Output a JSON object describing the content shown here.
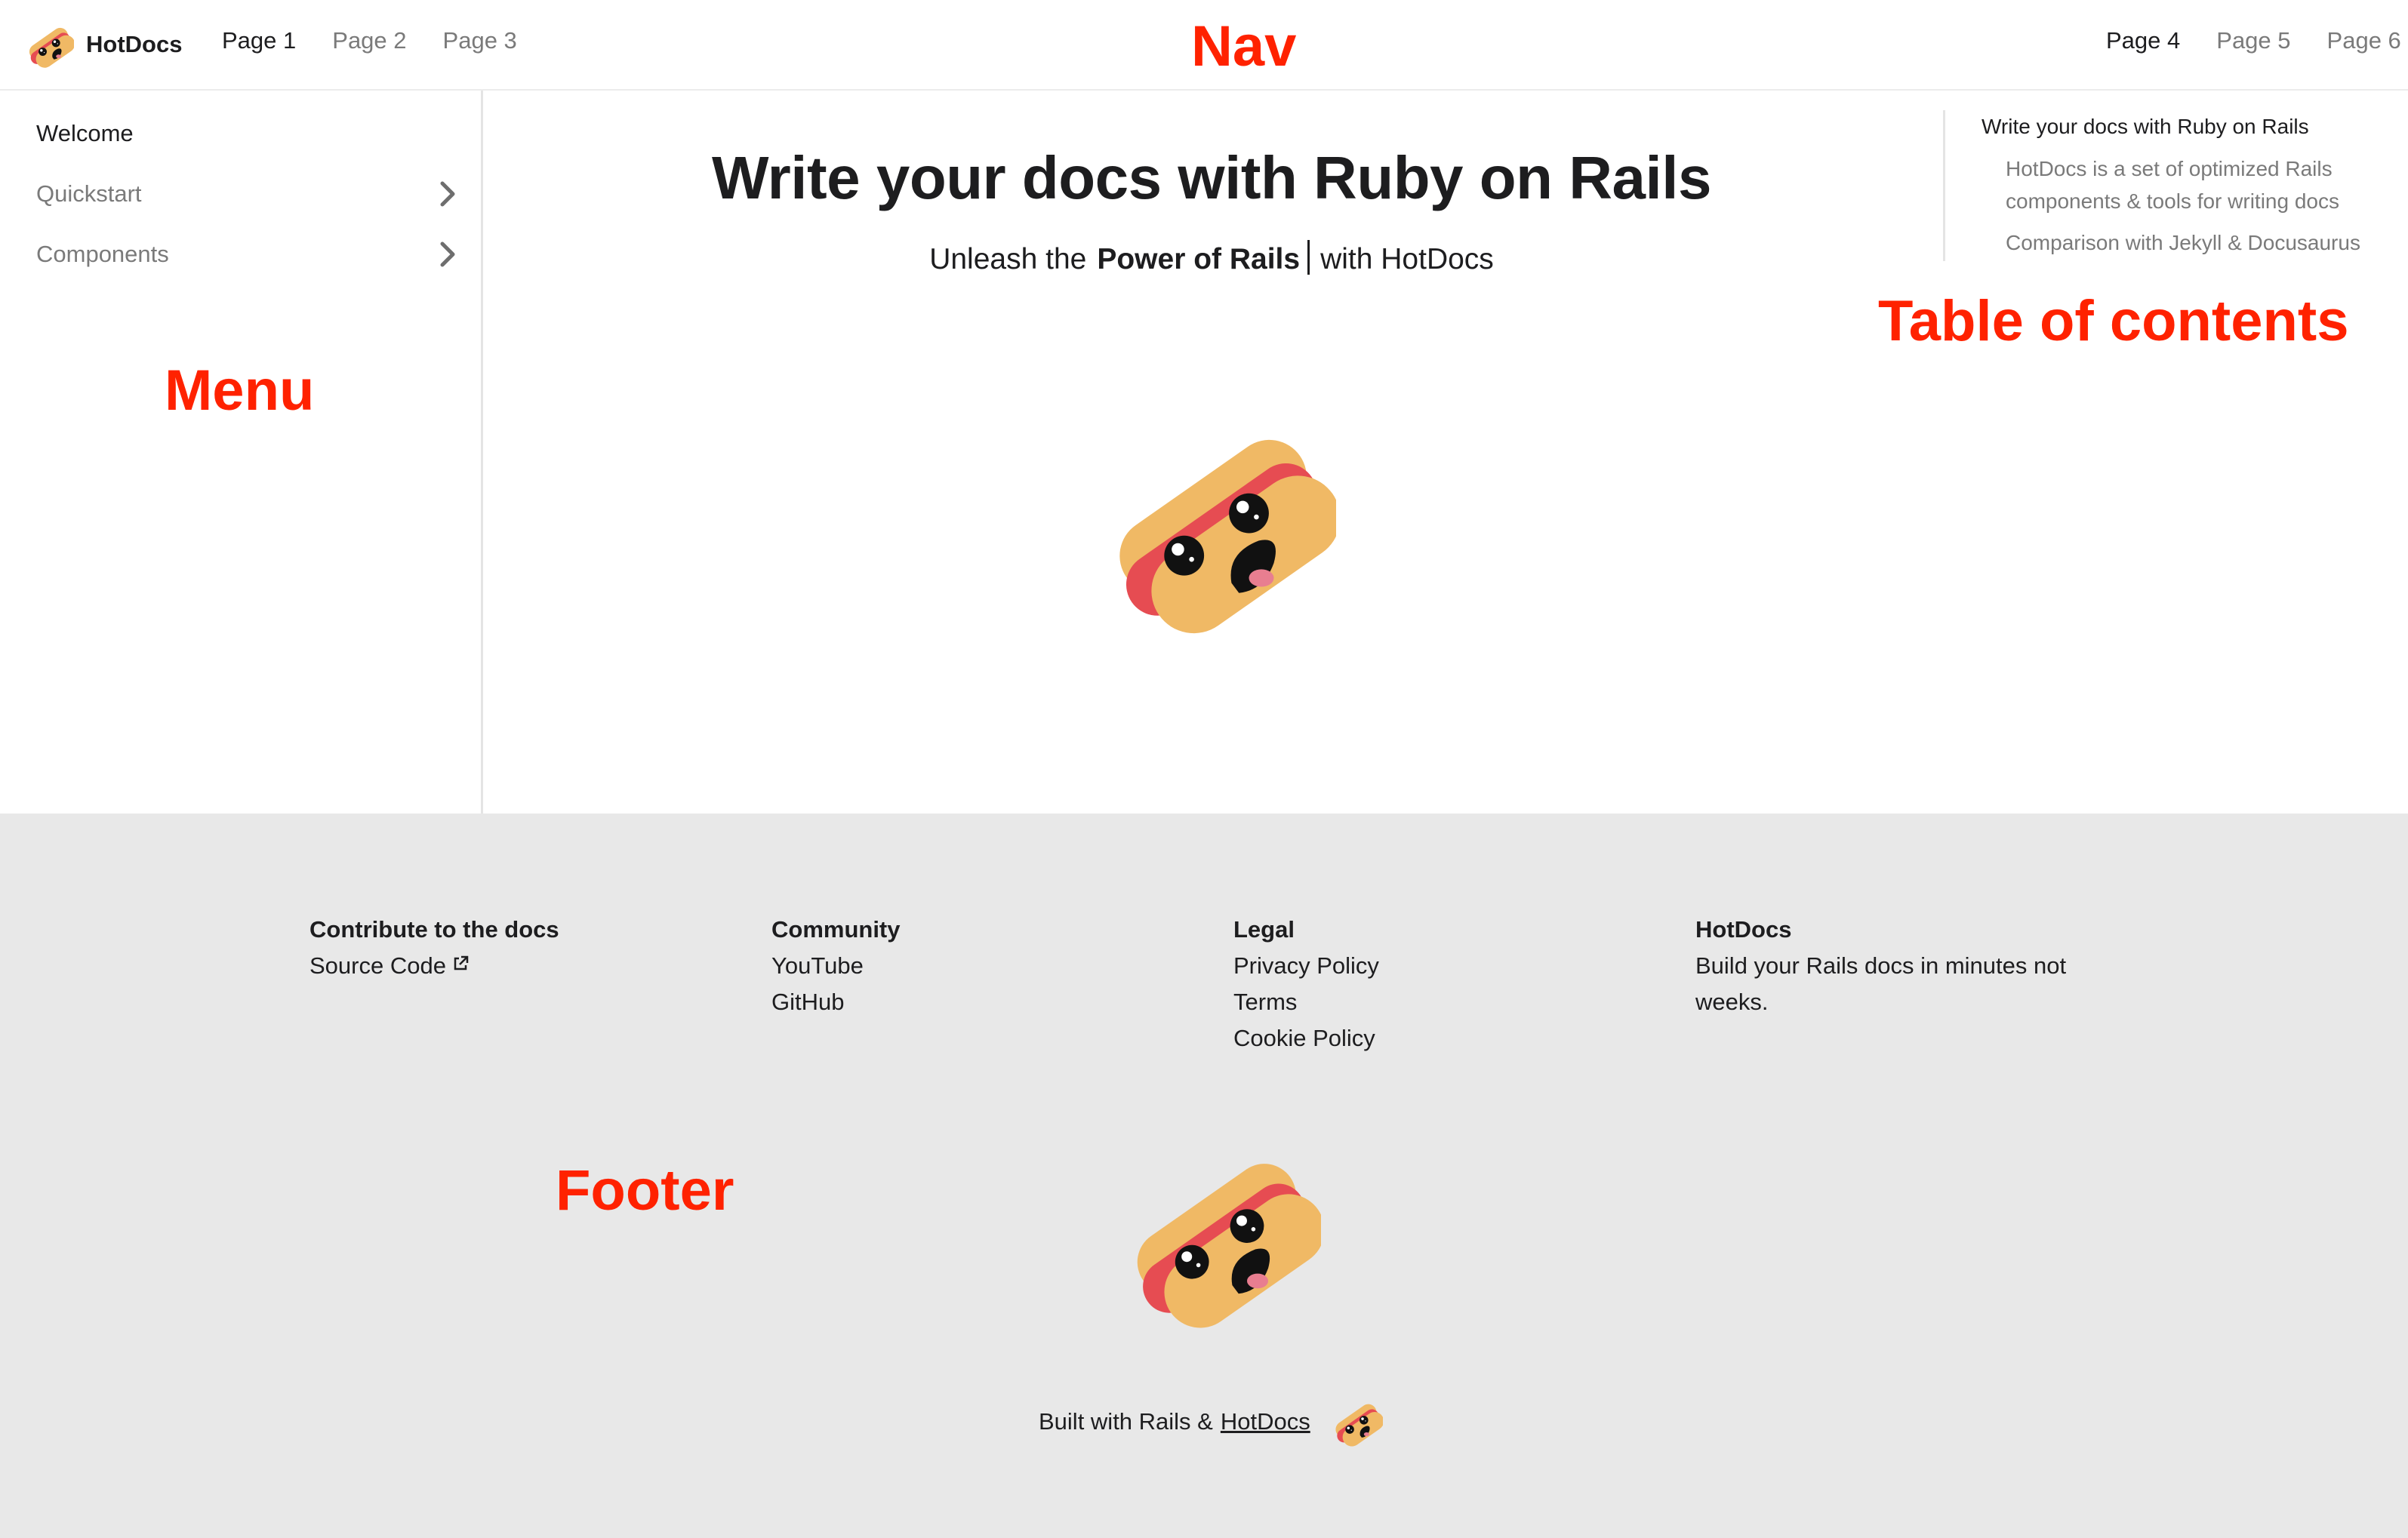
{
  "nav": {
    "brand": "HotDocs",
    "left_links": [
      "Page 1",
      "Page 2",
      "Page 3"
    ],
    "right_links": [
      "Page 4",
      "Page 5",
      "Page 6"
    ],
    "annotation": "Nav"
  },
  "sidebar": {
    "items": [
      {
        "label": "Welcome"
      },
      {
        "label": "Quickstart"
      },
      {
        "label": "Components"
      }
    ],
    "annotation": "Menu"
  },
  "main": {
    "title": "Write your docs with Ruby on Rails",
    "subtitle_prefix": "Unleash the",
    "subtitle_strong": "Power of Rails",
    "subtitle_suffix": "with HotDocs"
  },
  "toc": {
    "heading": "Write your docs with Ruby on Rails",
    "items": [
      "HotDocs is a set of optimized Rails components & tools for writing docs",
      "Comparison with Jekyll & Docusaurus"
    ],
    "annotation": "Table of contents"
  },
  "footer": {
    "columns": [
      {
        "heading": "Contribute to the docs",
        "links": [
          "Source Code"
        ]
      },
      {
        "heading": "Community",
        "links": [
          "YouTube",
          "GitHub"
        ]
      },
      {
        "heading": "Legal",
        "links": [
          "Privacy Policy",
          "Terms",
          "Cookie Policy"
        ]
      },
      {
        "heading": "HotDocs",
        "text_lines": [
          "Build your Rails docs in minutes not",
          "weeks."
        ]
      }
    ],
    "built_prefix": "Built with Rails &",
    "built_link": "HotDocs",
    "annotation": "Footer"
  },
  "colors": {
    "annotation": "#ff2200",
    "footer_bg": "#e8e8e8",
    "muted_text": "#7a7a7a",
    "sausage": "#e64c52",
    "bun": "#f0b965"
  },
  "icons": [
    "hotdog-logo-icon",
    "chevron-right-icon",
    "external-link-icon",
    "hotdog-mascot-icon"
  ]
}
